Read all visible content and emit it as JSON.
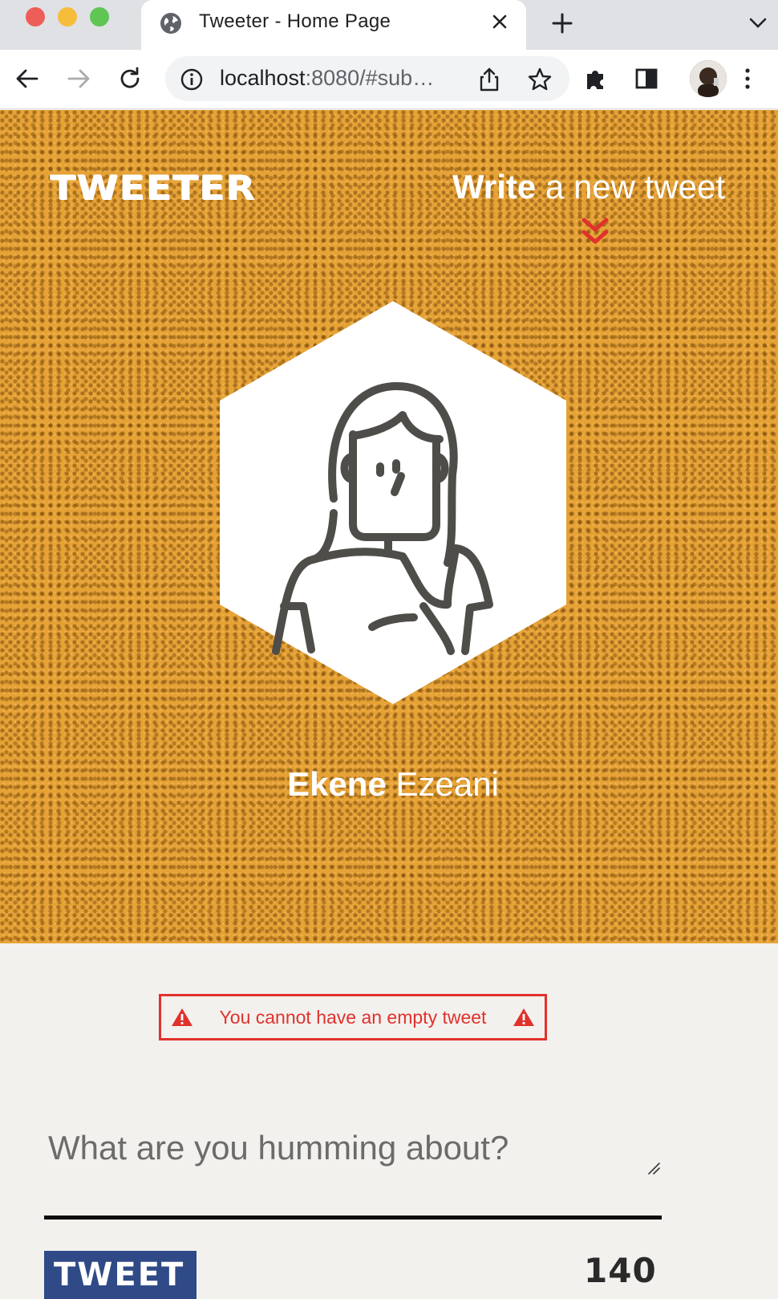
{
  "browser": {
    "tab_title": "Tweeter - Home Page",
    "url_host": "localhost",
    "url_rest": ":8080/#sub…"
  },
  "header": {
    "logo": "TWEETER",
    "write_bold": "Write",
    "write_rest": " a new tweet"
  },
  "profile": {
    "first_name": "Ekene",
    "last_name": " Ezeani"
  },
  "composer": {
    "error_message": "You cannot have an empty tweet",
    "placeholder": "What are you humming about?",
    "value": "",
    "submit_label": "TWEET",
    "char_counter": "140"
  },
  "colors": {
    "hero_bg": "#e6a235",
    "accent_red": "#e0322d",
    "button_blue": "#2f4a86",
    "page_bg": "#f3f1ee"
  }
}
